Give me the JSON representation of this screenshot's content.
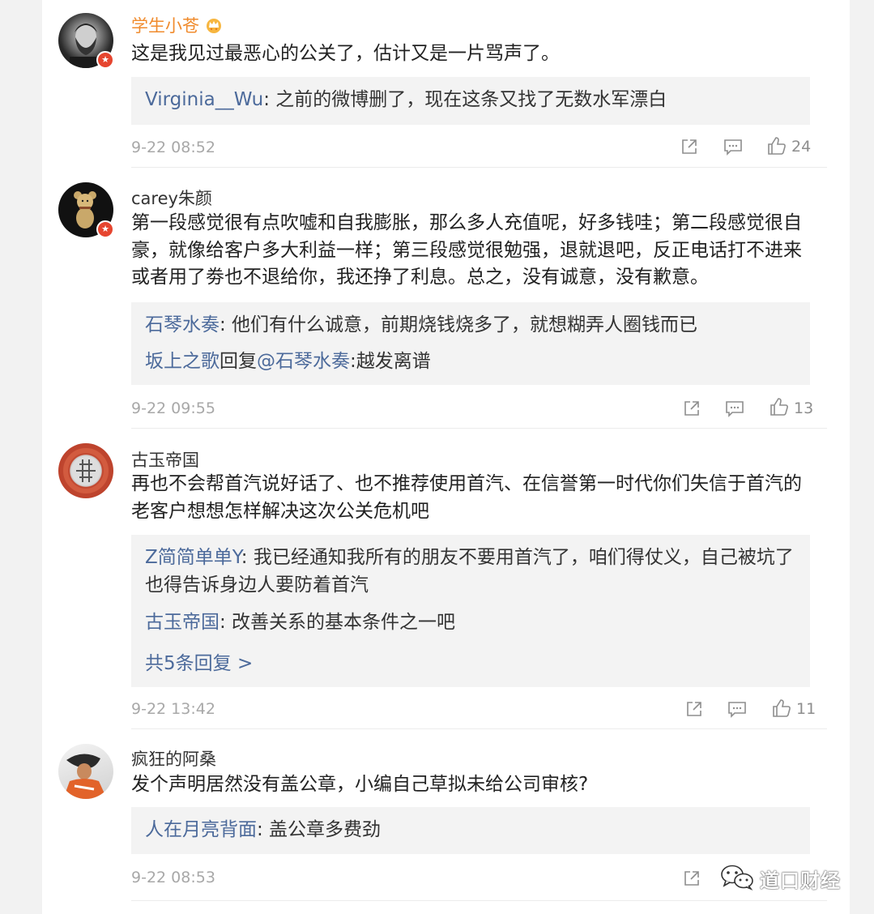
{
  "comments": [
    {
      "username": "学生小苍",
      "text": "这是我见过最恶心的公关了，估计又是一片骂声了。",
      "replies": [
        {
          "who": "Virginia__Wu",
          "text": ": 之前的微博删了，现在这条又找了无数水军漂白"
        }
      ],
      "time": "9-22 08:52",
      "likes": "24"
    },
    {
      "username": "carey朱颜",
      "text": "第一段感觉很有点吹嘘和自我膨胀，那么多人充值呢，好多钱哇；第二段感觉很自豪，就像给客户多大利益一样；第三段感觉很勉强，退就退吧，反正电话打不进来或者用了劵也不退给你，我还挣了利息。总之，没有诚意，没有歉意。",
      "replies": [
        {
          "who": "石琴水奏",
          "text": ": 他们有什么诚意，前期烧钱烧多了，就想糊弄人圈钱而已"
        },
        {
          "who": "坂上之歌",
          "text": "回复",
          "who2": "@石琴水奏",
          "text2": ":越发离谱"
        }
      ],
      "time": "9-22 09:55",
      "likes": "13"
    },
    {
      "username": "古玉帝国",
      "text": "再也不会帮首汽说好话了、也不推荐使用首汽、在信誉第一时代你们失信于首汽的老客户想想怎样解决这次公关危机吧",
      "replies": [
        {
          "who": "Z简简单单Y",
          "text": ": 我已经通知我所有的朋友不要用首汽了，咱们得仗义，自己被坑了也得告诉身边人要防着首汽"
        },
        {
          "who": "古玉帝国",
          "text": ": 改善关系的基本条件之一吧"
        }
      ],
      "more": "共5条回复 >",
      "time": "9-22 13:42",
      "likes": "11"
    },
    {
      "username": "疯狂的阿桑",
      "text": "发个声明居然没有盖公章，小编自己草拟未给公司审核?",
      "replies": [
        {
          "who": "人在月亮背面",
          "text": ": 盖公章多费劲"
        }
      ],
      "time": "9-22 08:53",
      "likes": ""
    }
  ],
  "watermark": "道口财经",
  "colors": {
    "link": "#4c6a9b",
    "username_highlight": "#f08b2d",
    "reply_background": "#f3f3f3",
    "verified_badge": "#e6452f",
    "meta_gray": "#a8a8a8"
  },
  "icons": [
    "share-icon",
    "comment-icon",
    "like-icon",
    "wechat-icon",
    "crown-icon",
    "verified-badge-icon"
  ]
}
